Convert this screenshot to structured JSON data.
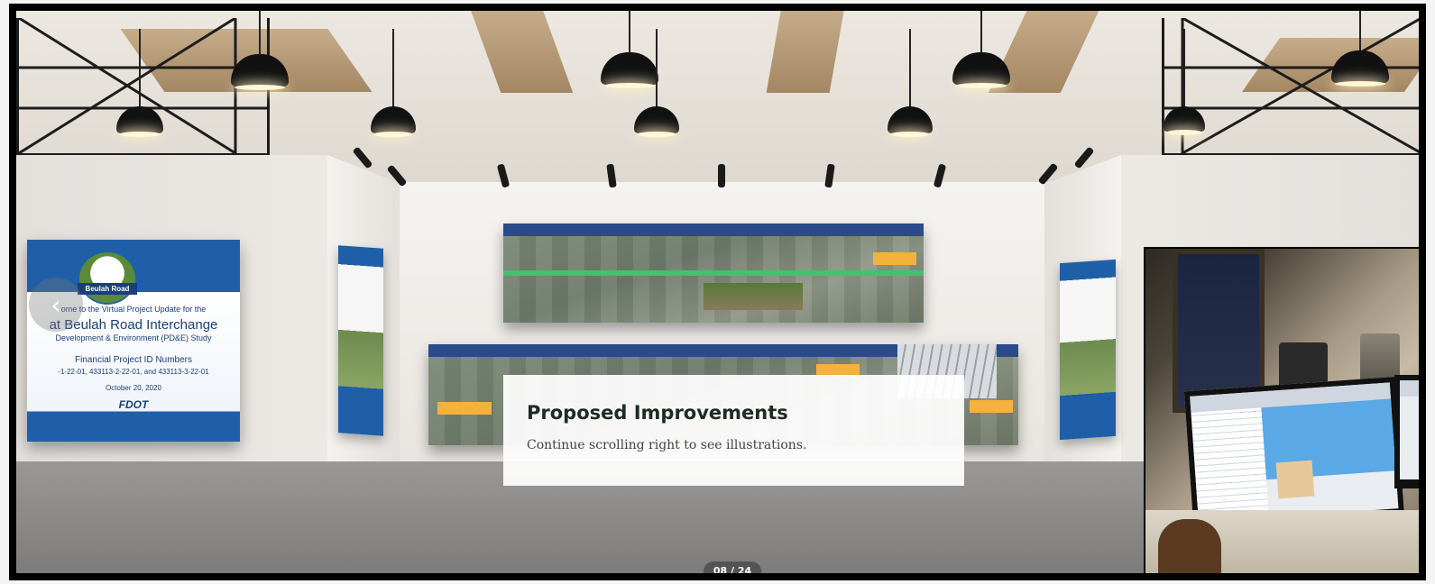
{
  "tour": {
    "prev_arrow": "‹",
    "caption": {
      "title": "Proposed Improvements",
      "body": "Continue scrolling right to see illustrations."
    },
    "pager": "08 / 24"
  },
  "title_slide": {
    "brand": "Beulah Road",
    "line1": "ome to the Virtual Project Update for the",
    "line2": "at Beulah Road Interchange",
    "line3": "Development & Environment (PD&E) Study",
    "line4": "Financial Project ID Numbers",
    "line5": "-1-22-01, 433113-2-22-01, and 433113-3-22-01",
    "date": "October 20, 2020",
    "logo": "FDOT"
  },
  "colors": {
    "fdot_blue": "#1f5fa8",
    "road_green": "#3ec46d",
    "callout_yellow": "#f5b13d"
  },
  "icons": {
    "prev": "chevron-left-icon"
  }
}
